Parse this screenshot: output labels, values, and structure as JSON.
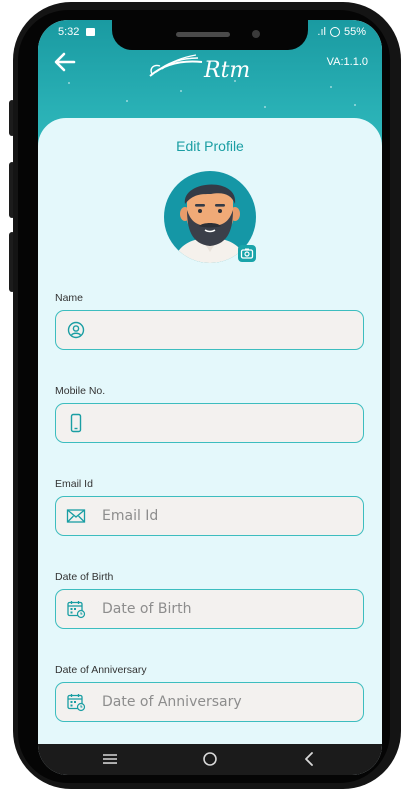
{
  "status_bar": {
    "time": "5:32",
    "signal": ".ıl",
    "battery": "55%"
  },
  "header": {
    "version": "VA:1.1.0",
    "logo_text": "Rtm"
  },
  "page": {
    "title": "Edit Profile"
  },
  "form": {
    "fields": [
      {
        "label": "Name",
        "icon": "user-icon",
        "value": "",
        "placeholder": ""
      },
      {
        "label": "Mobile No.",
        "icon": "phone-icon",
        "value": "",
        "placeholder": ""
      },
      {
        "label": "Email Id",
        "icon": "mail-icon",
        "value": "",
        "placeholder": "Email Id"
      },
      {
        "label": "Date of Birth",
        "icon": "calendar-icon",
        "value": "",
        "placeholder": "Date of Birth"
      },
      {
        "label": "Date of Anniversary",
        "icon": "calendar-icon",
        "value": "",
        "placeholder": "Date of Anniversary"
      }
    ]
  },
  "nav_bar": {
    "items": [
      "recents",
      "home",
      "back"
    ]
  },
  "colors": {
    "primary": "#1a9ea3",
    "field_border": "#3cbdbf",
    "field_bg": "#f3f1ef",
    "card_bg": "#e4f8fb"
  }
}
